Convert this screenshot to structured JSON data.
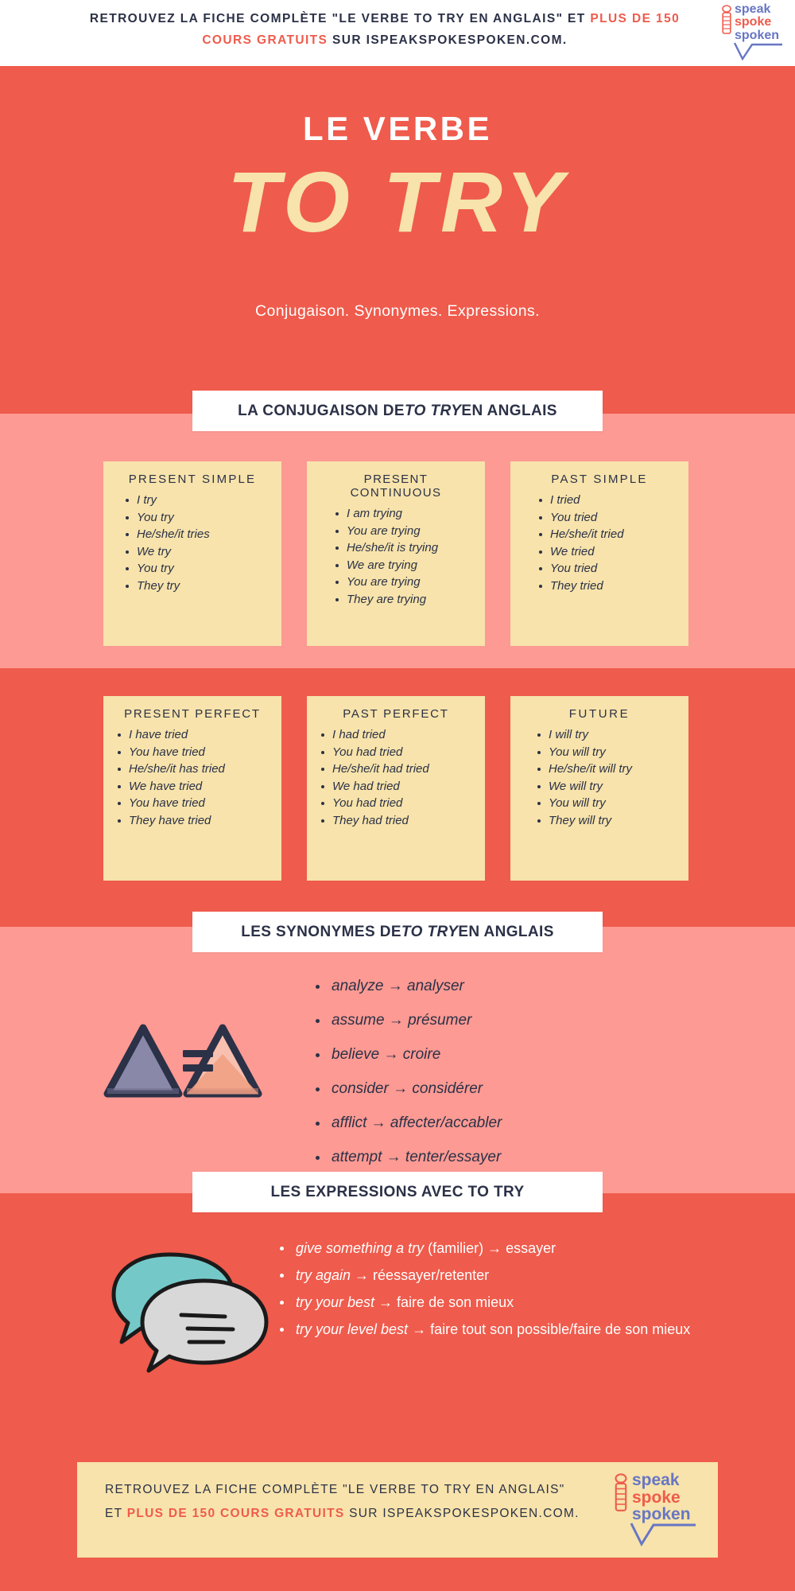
{
  "topbar": {
    "part1": "RETROUVEZ LA FICHE COMPLÈTE \"LE VERBE TO  TRY  EN ANGLAIS\" ET ",
    "highlight": "PLUS DE 150 COURS GRATUITS",
    "part2": " SUR ISPEAKSPOKESPOKEN.COM."
  },
  "logo": {
    "word1": "speak",
    "word2": "spoke",
    "word3": "spoken",
    "icon": "microphone-icon",
    "check": "checkmark-icon"
  },
  "hero": {
    "eyebrow": "LE VERBE",
    "title": "TO TRY",
    "subtitle": "Conjugaison. Synonymes.  Expressions."
  },
  "sections": {
    "conjugation": {
      "banner_before": "LA CONJUGAISON DE ",
      "banner_italic": "TO TRY",
      "banner_after": " EN ANGLAIS",
      "cards": [
        {
          "title": "PRESENT SIMPLE",
          "items": [
            "I try",
            "You try",
            "He/she/it tries",
            "We try",
            "You try",
            "They try"
          ]
        },
        {
          "title": "PRESENT CONTINUOUS",
          "items": [
            "I am trying",
            "You are trying",
            "He/she/it is trying",
            "We are trying",
            "You are trying",
            "They are trying"
          ]
        },
        {
          "title": "PAST SIMPLE",
          "items": [
            "I tried",
            "You tried",
            "He/she/it tried",
            "We tried",
            "You tried",
            "They tried"
          ]
        },
        {
          "title": "PRESENT PERFECT",
          "items": [
            "I have tried",
            "You have tried",
            "He/she/it has tried",
            "We have tried",
            "You have tried",
            "They have tried"
          ]
        },
        {
          "title": "PAST PERFECT",
          "items": [
            "I had tried",
            "You had tried",
            "He/she/it had tried",
            "We had tried",
            "You had tried",
            "They had tried"
          ]
        },
        {
          "title": "FUTURE",
          "items": [
            "I will try",
            "You will try",
            "He/she/it will try",
            "We will try",
            "You will try",
            "They will try"
          ]
        }
      ]
    },
    "synonyms": {
      "banner_before": "LES SYNONYMES DE ",
      "banner_italic": "TO  TRY",
      "banner_after": " EN ANGLAIS",
      "icon": "equal-triangles-icon",
      "items": [
        "analyze → analyser",
        "assume → présumer",
        "believe → croire",
        "consider → considérer",
        "afflict → affecter/accabler",
        "attempt → tenter/essayer"
      ]
    },
    "expressions": {
      "banner": "LES EXPRESSIONS AVEC TO TRY",
      "icon": "speech-bubbles-icon",
      "items": [
        {
          "en": "give something a try",
          "fr": " (familier) → essayer"
        },
        {
          "en": "try again",
          "fr": " → réessayer/retenter"
        },
        {
          "en": "try your best",
          "fr": " → faire de son mieux"
        },
        {
          "en": "try your level best",
          "fr": " → faire tout son possible/faire de son mieux"
        }
      ]
    }
  },
  "footer": {
    "part1": "RETROUVEZ LA FICHE COMPLÈTE \"LE VERBE TO TRY EN ANGLAIS\" ET ",
    "highlight": "PLUS DE 150 COURS GRATUITS",
    "part2": " SUR ISPEAKSPOKESPOKEN.COM."
  },
  "colors": {
    "band_dark": "#ef5b4c",
    "band_light": "#fd9a93",
    "card": "#f7e3ab",
    "title_cream": "#f7e3ab",
    "ink": "#2b3147",
    "logo_blue": "#6776c4",
    "bubble_teal": "#74c9c8",
    "bubble_gray": "#d8d8d8",
    "triangle_purple": "#8a88a8",
    "triangle_peach": "#f4b496"
  }
}
